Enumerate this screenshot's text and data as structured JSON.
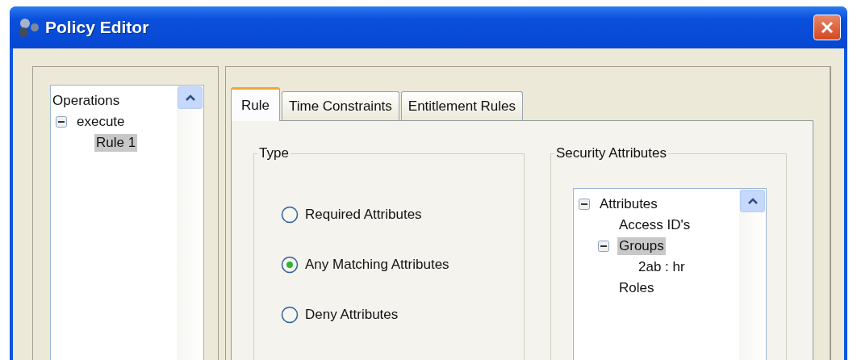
{
  "window": {
    "title": "Policy Editor"
  },
  "operations_tree": [
    {
      "label": "Operations",
      "selected": false,
      "children": [
        {
          "label": "execute",
          "expanded": true,
          "selected": false,
          "children": [
            {
              "label": "Rule 1",
              "selected": true
            }
          ]
        }
      ]
    }
  ],
  "tabs": [
    {
      "label": "Rule",
      "selected": true
    },
    {
      "label": "Time Constraints",
      "selected": false
    },
    {
      "label": "Entitlement Rules",
      "selected": false
    }
  ],
  "type_group": {
    "title": "Type",
    "options": [
      {
        "label": "Required Attributes",
        "selected": false
      },
      {
        "label": "Any Matching Attributes",
        "selected": true
      },
      {
        "label": "Deny Attributes",
        "selected": false
      }
    ]
  },
  "security_group": {
    "title": "Security Attributes",
    "tree": [
      {
        "label": "Attributes",
        "expanded": true,
        "selected": false,
        "children": [
          {
            "label": "Access ID's",
            "selected": false
          },
          {
            "label": "Groups",
            "expanded": true,
            "selected": true,
            "children": [
              {
                "label": "2ab : hr",
                "selected": false
              }
            ]
          },
          {
            "label": "Roles",
            "selected": false
          }
        ]
      }
    ]
  }
}
